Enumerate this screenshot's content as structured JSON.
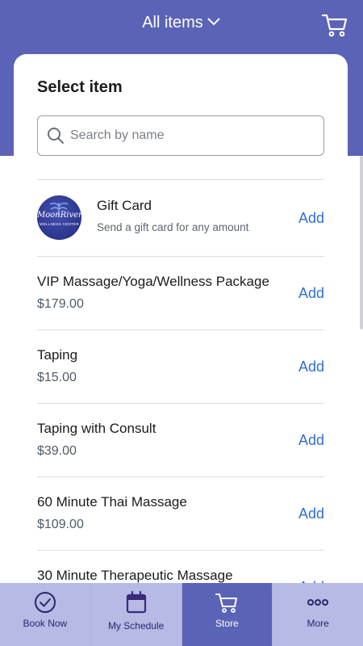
{
  "header": {
    "title": "All items"
  },
  "card": {
    "title": "Select item"
  },
  "search": {
    "placeholder": "Search by name"
  },
  "gift": {
    "name": "Gift Card",
    "description": "Send a gift card for any amount",
    "logo_text": "MoonRiver",
    "logo_sub": "WELLNESS CENTER"
  },
  "items": [
    {
      "name": "VIP Massage/Yoga/Wellness Package",
      "price": "$179.00"
    },
    {
      "name": "Taping",
      "price": "$15.00"
    },
    {
      "name": "Taping with Consult",
      "price": "$39.00"
    },
    {
      "name": "60 Minute Thai Massage",
      "price": "$109.00"
    },
    {
      "name": "30 Minute Therapeutic Massage",
      "price": ""
    }
  ],
  "add_label": "Add",
  "tabs": [
    {
      "label": "Book Now",
      "icon": "check-circle-icon"
    },
    {
      "label": "My Schedule",
      "icon": "calendar-icon"
    },
    {
      "label": "Store",
      "icon": "cart-icon"
    },
    {
      "label": "More",
      "icon": "more-dots-icon"
    }
  ],
  "colors": {
    "primary": "#5a63b6",
    "tabbar": "#b6bae4",
    "link": "#2f6fd6"
  }
}
